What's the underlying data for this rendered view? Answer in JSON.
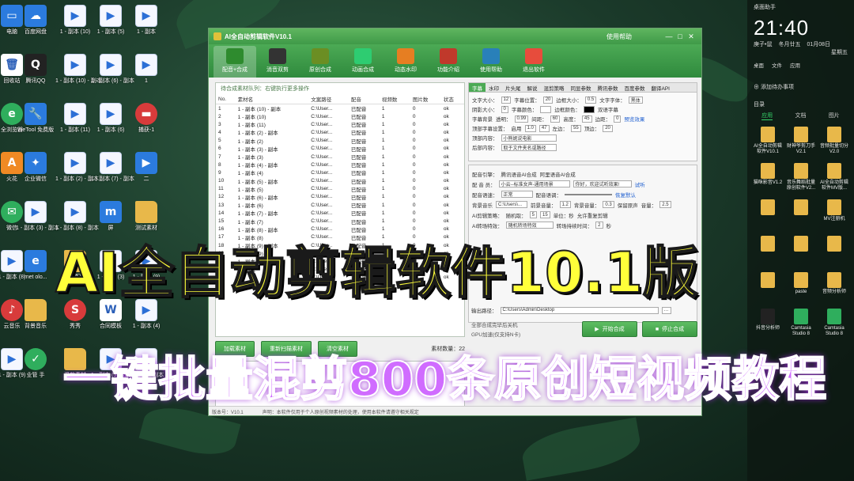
{
  "desktop_icons": [
    {
      "label": "电脑",
      "kind": "app-blue",
      "glyph": "▭"
    },
    {
      "label": "百度网盘",
      "kind": "app-blue",
      "glyph": "☁"
    },
    {
      "label": "1 - 副本 (10)",
      "kind": "video",
      "glyph": "▶"
    },
    {
      "label": "1 - 副本 (5)",
      "kind": "video",
      "glyph": "▶"
    },
    {
      "label": "1 - 副本",
      "kind": "video",
      "glyph": "▶"
    },
    {
      "label": "回收站",
      "kind": "doc",
      "glyph": "🗑"
    },
    {
      "label": "腾讯QQ",
      "kind": "app-dark",
      "glyph": "Q"
    },
    {
      "label": "1 - 副本 (10) - 副本",
      "kind": "video",
      "glyph": "▶"
    },
    {
      "label": "1 - 副本 (6) - 副本",
      "kind": "video",
      "glyph": "▶"
    },
    {
      "label": "1",
      "kind": "video",
      "glyph": "▶"
    },
    {
      "label": "全浏览器",
      "kind": "app-green",
      "glyph": "e"
    },
    {
      "label": "WeTool 免费版",
      "kind": "app-blue",
      "glyph": "🔧"
    },
    {
      "label": "1 - 副本 (11)",
      "kind": "video",
      "glyph": "▶"
    },
    {
      "label": "1 - 副本 (6)",
      "kind": "video",
      "glyph": "▶"
    },
    {
      "label": "捕获-1",
      "kind": "app-red",
      "glyph": "▬"
    },
    {
      "label": "火花",
      "kind": "app-orange",
      "glyph": "A"
    },
    {
      "label": "企业微信",
      "kind": "app-blue",
      "glyph": "✦"
    },
    {
      "label": "1 - 副本 (2) - 副本",
      "kind": "video",
      "glyph": "▶"
    },
    {
      "label": "1 - 副本 (7) - 副本",
      "kind": "video",
      "glyph": "▶"
    },
    {
      "label": "二",
      "kind": "app-blue",
      "glyph": "▶"
    },
    {
      "label": "微信",
      "kind": "app-green",
      "glyph": "✉"
    },
    {
      "label": "1 - 副本 (3) - 副本",
      "kind": "video",
      "glyph": "▶"
    },
    {
      "label": "1 - 副本 (8) - 副本",
      "kind": "video",
      "glyph": "▶"
    },
    {
      "label": "屏",
      "kind": "app-blue",
      "glyph": "m"
    },
    {
      "label": "测试素材",
      "kind": "folder",
      "glyph": ""
    },
    {
      "label": "1 - 副本 (8)",
      "kind": "video",
      "glyph": "▶"
    },
    {
      "label": "rnet\nolo...",
      "kind": "app-blue",
      "glyph": "e"
    },
    {
      "label": "文章配图",
      "kind": "folder",
      "glyph": ""
    },
    {
      "label": "1 - 副本 (3)",
      "kind": "video",
      "glyph": "▶"
    },
    {
      "label": "1 - 副本 (9)",
      "kind": "video",
      "glyph": "▶"
    },
    {
      "label": "云音乐",
      "kind": "app-red",
      "glyph": "♪"
    },
    {
      "label": "背景音乐",
      "kind": "folder",
      "glyph": ""
    },
    {
      "label": "秀秀",
      "kind": "app-red",
      "glyph": "S"
    },
    {
      "label": "合同模板",
      "kind": "doc",
      "glyph": "W"
    },
    {
      "label": "1 - 副本 (4)",
      "kind": "video",
      "glyph": "▶"
    },
    {
      "label": "1 - 副本 (9)",
      "kind": "video",
      "glyph": "▶"
    },
    {
      "label": "业管 手",
      "kind": "app-green",
      "glyph": "✓"
    },
    {
      "label": "混剪素材",
      "kind": "folder",
      "glyph": ""
    },
    {
      "label": "1 - 副本 (5) - 副本",
      "kind": "video",
      "glyph": "▶"
    },
    {
      "label": "1 - 副本 - 副本",
      "kind": "video",
      "glyph": "▶"
    }
  ],
  "window": {
    "title": "AI全自动剪辑软件V10.1",
    "help": "使用帮助",
    "min": "—",
    "max": "□",
    "close": "✕",
    "toolbar": [
      {
        "label": "配音+合成",
        "color": "#2e8b2e"
      },
      {
        "label": "消音双剪",
        "color": "#333333"
      },
      {
        "label": "原创合成",
        "color": "#6b8e23"
      },
      {
        "label": "动画合成",
        "color": "#2ecc71"
      },
      {
        "label": "动态水印",
        "color": "#e67e22"
      },
      {
        "label": "功能介绍",
        "color": "#c0392b"
      },
      {
        "label": "使用帮助",
        "color": "#2980b9"
      },
      {
        "label": "退出软件",
        "color": "#e74c3c"
      }
    ],
    "file_list": {
      "caption": "待合成素材队列：右键执行更多操作",
      "columns": [
        "No.",
        "素材名",
        "文案路径",
        "配音",
        "视频数",
        "图片数",
        "状态"
      ],
      "rows": [
        [
          "1",
          "1 - 副本 (10) - 副本",
          "C:\\User...",
          "已配音",
          "1",
          "0",
          "ok"
        ],
        [
          "2",
          "1 - 副本 (10)",
          "C:\\User...",
          "已配音",
          "1",
          "0",
          "ok"
        ],
        [
          "3",
          "1 - 副本 (11)",
          "C:\\User...",
          "已配音",
          "1",
          "0",
          "ok"
        ],
        [
          "4",
          "1 - 副本 (2) - 副本",
          "C:\\User...",
          "已配音",
          "1",
          "0",
          "ok"
        ],
        [
          "5",
          "1 - 副本 (2)",
          "C:\\User...",
          "已配音",
          "1",
          "0",
          "ok"
        ],
        [
          "6",
          "1 - 副本 (3) - 副本",
          "C:\\User...",
          "已配音",
          "1",
          "0",
          "ok"
        ],
        [
          "7",
          "1 - 副本 (3)",
          "C:\\User...",
          "已配音",
          "1",
          "0",
          "ok"
        ],
        [
          "8",
          "1 - 副本 (4) - 副本",
          "C:\\User...",
          "已配音",
          "1",
          "0",
          "ok"
        ],
        [
          "9",
          "1 - 副本 (4)",
          "C:\\User...",
          "已配音",
          "1",
          "0",
          "ok"
        ],
        [
          "10",
          "1 - 副本 (5) - 副本",
          "C:\\User...",
          "已配音",
          "1",
          "0",
          "ok"
        ],
        [
          "11",
          "1 - 副本 (5)",
          "C:\\User...",
          "已配音",
          "1",
          "0",
          "ok"
        ],
        [
          "12",
          "1 - 副本 (6) - 副本",
          "C:\\User...",
          "已配音",
          "1",
          "0",
          "ok"
        ],
        [
          "13",
          "1 - 副本 (6)",
          "C:\\User...",
          "已配音",
          "1",
          "0",
          "ok"
        ],
        [
          "14",
          "1 - 副本 (7) - 副本",
          "C:\\User...",
          "已配音",
          "1",
          "0",
          "ok"
        ],
        [
          "15",
          "1 - 副本 (7)",
          "C:\\User...",
          "已配音",
          "1",
          "0",
          "ok"
        ],
        [
          "16",
          "1 - 副本 (8) - 副本",
          "C:\\User...",
          "已配音",
          "1",
          "0",
          "ok"
        ],
        [
          "17",
          "1 - 副本 (8)",
          "C:\\User...",
          "已配音",
          "1",
          "0",
          "ok"
        ],
        [
          "18",
          "1 - 副本 (9) - 副本",
          "C:\\User...",
          "已配音",
          "1",
          "0",
          "ok"
        ],
        [
          "19",
          "1 - 副本 (9)",
          "C:\\User...",
          "已配音",
          "1",
          "0",
          "ok"
        ],
        [
          "20",
          "1 - 副本 - 副本",
          "C:\\User...",
          "已配音",
          "1",
          "0",
          "ok"
        ],
        [
          "21",
          "1 - 副本",
          "C:\\User...",
          "已配音",
          "1",
          "0",
          "ok"
        ],
        [
          "22",
          "1",
          "C:\\User...",
          "已配音",
          "1",
          "0",
          "ok"
        ]
      ]
    },
    "buttons": {
      "load": "加载素材",
      "rescan": "重新扫描素材",
      "clear": "清空素材"
    },
    "count_label": "素材数量：22",
    "log_label": "运行日志：",
    "status_version": "版本号：V10.1",
    "status_notice": "声明：本软件仅用于个人原创视频素材的处理，使用本软件请遵守相关规定",
    "tabs": [
      "字幕",
      "水印",
      "片头尾",
      "解说",
      "混剪策略",
      "同显参数",
      "腾讯参数",
      "百度参数",
      "翻译API"
    ],
    "subtitle_settings": {
      "font_size_label": "文字大小：",
      "font_size": "12",
      "pos_label": "字幕位置：",
      "pos": "20",
      "border_label": "边框大小：",
      "border": "0.5",
      "font_label": "文字字体：",
      "font": "黑体",
      "shadow_label": "阴影大小：",
      "shadow": "0",
      "color_label": "字幕颜色：",
      "bcolor_label": "边框颜色：",
      "dual_label": "双语字幕",
      "bg_label": "字幕背景",
      "alpha_label": "透明：",
      "alpha": "0.99",
      "spacing_label": "间距：",
      "spacing": "60",
      "height_label": "高度：",
      "height": "45",
      "margin_label": "边距：",
      "margin": "0",
      "preview": "预览效果",
      "top_label": "顶部字幕设置：",
      "enable": "启用",
      "alpha2": "1.0",
      "h2": "47",
      "left_label": "左边：",
      "left": "55",
      "top_label2": "顶边：",
      "top": "20",
      "top_content_label": "顶部内容：",
      "top_content": "小熊妮说电影",
      "end_content_label": "后部内容：",
      "end_content": "取于文件夹名或路径"
    },
    "voice": {
      "engine_label": "配音引擎：",
      "opt1": "腾讯语音AI合成",
      "opt2": "阿里语音AI合成",
      "speaker_label": "配 音 员：",
      "speaker": "小云--标准女声-通用场景",
      "sample": "你好，欢迎试听效果!",
      "listen": "试听",
      "speed_label": "配音语速：",
      "speed": "正常",
      "rate_label": "配音语调：",
      "reset": "恢复默认",
      "bgm_label": "背景音乐",
      "bgm_path": "C:\\Users\\...",
      "vol1_label": "前景音量：",
      "vol1": "1.2",
      "vol2_label": "背景音量：",
      "vol2": "0.3",
      "keep_label": "保留原声",
      "keep_vol_label": "音量：",
      "keep_vol": "2.5",
      "ai_cut_label": "AI剪辑策略：",
      "random_label": "随机取：",
      "r1": "5",
      "r2": "15",
      "unit": "单位：秒",
      "allow_repeat": "允许重复剪辑",
      "transition_label": "AI转场特效：",
      "transition": "随机转场特效",
      "trans_time_label": "转场持续时间：",
      "trans_time": "2",
      "sec": "秒"
    },
    "output_label": "输出路径：",
    "output_path": "C:\\Users\\Admin\\Desktop",
    "shutdown": "全部合成完毕后关机",
    "gpu": "GPU加速(仅支持N卡)",
    "start": "开始合成",
    "stop": "停止合成"
  },
  "sidebar": {
    "app": "桌面助手",
    "time": "21:40",
    "date_line1": "庚子•鼠",
    "date_line2": "冬月廿五",
    "date_line3": "01月08日",
    "weekday": "星期五",
    "quick": [
      "桌面",
      "文件",
      "应用"
    ],
    "add_label": "添加待办事项",
    "dir_label": "目录",
    "tabs": [
      "应用",
      "文档",
      "图片"
    ],
    "items": [
      {
        "label": "AI全自动剪辑软件V10.1",
        "kind": "folder"
      },
      {
        "label": "财神爷剪刀手 V2.1",
        "kind": "folder"
      },
      {
        "label": "音频批量切分 V2.0",
        "kind": "folder"
      },
      {
        "label": "猫咪影音V1.2",
        "kind": "folder"
      },
      {
        "label": "音乐舞蹈批量原创软件V2...",
        "kind": "folder"
      },
      {
        "label": "AI全自动剪辑软件MV版...",
        "kind": "folder"
      },
      {
        "label": "",
        "kind": "folder"
      },
      {
        "label": "",
        "kind": "folder"
      },
      {
        "label": "MV注册机",
        "kind": "folder"
      },
      {
        "label": "",
        "kind": "folder"
      },
      {
        "label": "",
        "kind": "folder"
      },
      {
        "label": "",
        "kind": "folder"
      },
      {
        "label": "",
        "kind": "folder"
      },
      {
        "label": "paste",
        "kind": "folder"
      },
      {
        "label": "音频分析师",
        "kind": "folder"
      },
      {
        "label": "抖音分析师",
        "kind": "app-dark"
      },
      {
        "label": "Camtasia Studio 8",
        "kind": "app-green"
      },
      {
        "label": "Camtasia Studio 8",
        "kind": "app-green"
      }
    ]
  },
  "overlay": {
    "headline": "AI全自动剪辑软件10.1版",
    "subline": "一键批量混剪800条原创短视频教程"
  }
}
